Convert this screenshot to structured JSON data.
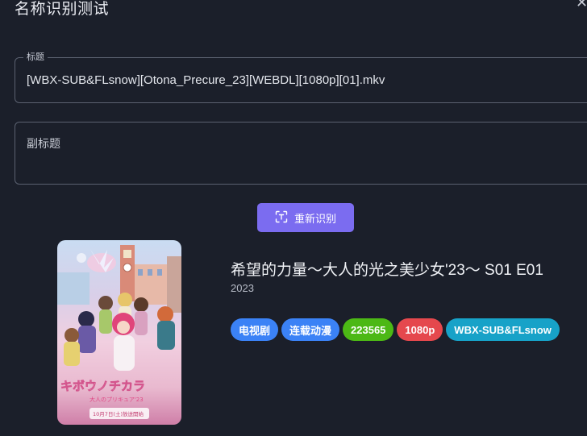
{
  "dialog": {
    "title": "名称识别测试",
    "close_icon": "close-icon"
  },
  "title_field": {
    "label": "标题",
    "value": "[WBX-SUB&FLsnow][Otona_Precure_23][WEBDL][1080p][01].mkv"
  },
  "subtitle_field": {
    "label": "副标题",
    "value": ""
  },
  "rerecognize_button": {
    "label": "重新识别",
    "icon": "scan-text-icon",
    "color": "#7b6cf0"
  },
  "result": {
    "title": "希望的力量～大人的光之美少女'23～ S01 E01",
    "year": "2023",
    "poster": {
      "text_logo": "キボウノチカラ",
      "text_sub": "大人のプリキュア'23",
      "text_date": "10月7日(土)放送開始"
    },
    "tags": [
      {
        "label": "电视剧",
        "color": "#3b82f6"
      },
      {
        "label": "连载动漫",
        "color": "#3b82f6"
      },
      {
        "label": "223565",
        "color": "#4cb815"
      },
      {
        "label": "1080p",
        "color": "#e5484d"
      },
      {
        "label": "WBX-SUB&FLsnow",
        "color": "#17a2c8"
      }
    ]
  }
}
